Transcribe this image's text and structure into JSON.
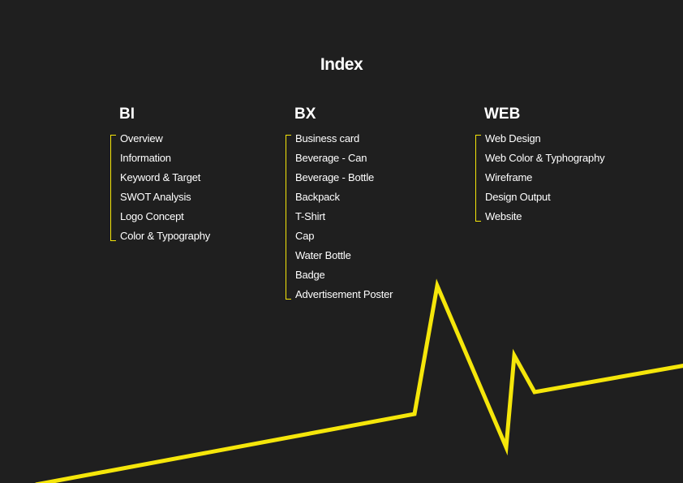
{
  "title": "Index",
  "sections": [
    {
      "title": "BI",
      "items": [
        "Overview",
        "Information",
        "Keyword & Target",
        "SWOT Analysis",
        "Logo Concept",
        "Color & Typography"
      ]
    },
    {
      "title": "BX",
      "items": [
        "Business card",
        "Beverage - Can",
        "Beverage - Bottle",
        "Backpack",
        "T-Shirt",
        "Cap",
        "Water Bottle",
        "Badge",
        "Advertisement Poster"
      ]
    },
    {
      "title": "WEB",
      "items": [
        "Web Design",
        "Web Color & Typhography",
        "Wireframe",
        "Design Output",
        "Website"
      ]
    }
  ],
  "colors": {
    "background": "#1f1f1f",
    "accent": "#f5e60a",
    "text": "#ffffff"
  }
}
